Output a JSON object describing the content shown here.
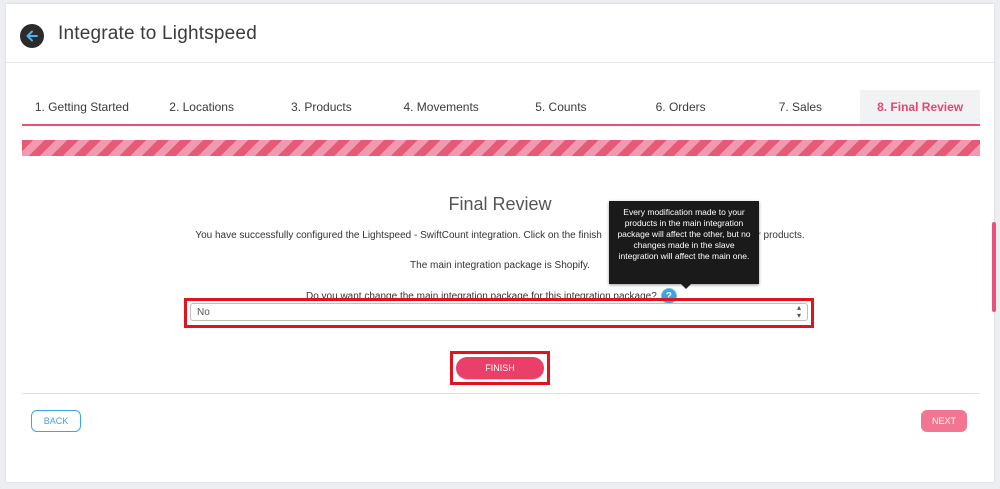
{
  "header": {
    "title": "Integrate to Lightspeed",
    "back_icon": "arrow-left-icon"
  },
  "tabs": [
    {
      "label": "1. Getting Started",
      "active": false
    },
    {
      "label": "2. Locations",
      "active": false
    },
    {
      "label": "3. Products",
      "active": false
    },
    {
      "label": "4. Movements",
      "active": false
    },
    {
      "label": "5. Counts",
      "active": false
    },
    {
      "label": "6. Orders",
      "active": false
    },
    {
      "label": "7. Sales",
      "active": false
    },
    {
      "label": "8. Final Review",
      "active": true
    }
  ],
  "main": {
    "section_title": "Final Review",
    "description_start": "You have successfully configured the Lightspeed - SwiftCount integration. Click on the finish",
    "description_end": "ur products.",
    "main_package_text": "The main integration package is Shopify.",
    "question": "Do you want change the main integration package for this integration package?",
    "help_glyph": "?",
    "tooltip": "Every modification made to your products in the main integration package will affect the other, but no changes made in the slave integration will affect the main one.",
    "select_value": "No",
    "finish_label": "FINISH"
  },
  "footer": {
    "back_label": "BACK",
    "next_label": "NEXT"
  },
  "colors": {
    "accent": "#ea3f68",
    "link": "#3ca7dd",
    "highlight": "#e0141e"
  }
}
